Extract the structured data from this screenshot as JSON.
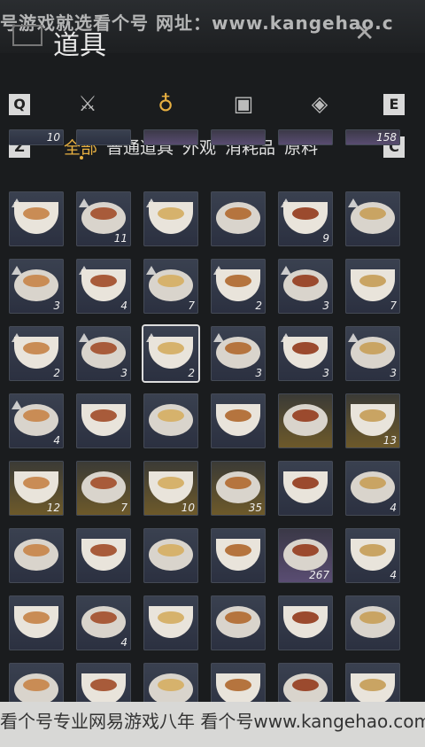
{
  "header": {
    "watermark_top": "号游戏就选看个号  网址：www.kangehao.c",
    "title": "道具",
    "close_icon": "close-x"
  },
  "categories": {
    "left_key": "Q",
    "right_key": "E",
    "icons": [
      "crossed-swords-icon",
      "pouch-icon",
      "chest-icon",
      "gem-icon"
    ],
    "active_index": 1
  },
  "tabs": {
    "left_key": "Z",
    "right_key": "C",
    "items": [
      "全部",
      "普通道具",
      "外观",
      "消耗品",
      "原料"
    ],
    "active_index": 0
  },
  "inventory": [
    {
      "row": 0,
      "col": 0,
      "qty": "10",
      "style": "blue"
    },
    {
      "row": 0,
      "col": 1,
      "qty": "",
      "style": "blue"
    },
    {
      "row": 0,
      "col": 2,
      "qty": "",
      "style": "purple"
    },
    {
      "row": 0,
      "col": 3,
      "qty": "",
      "style": "purple"
    },
    {
      "row": 0,
      "col": 4,
      "qty": "",
      "style": "purple"
    },
    {
      "row": 0,
      "col": 5,
      "qty": "158",
      "style": "purple"
    },
    {
      "row": 1,
      "col": 0,
      "qty": "",
      "style": "blue",
      "badge": true
    },
    {
      "row": 1,
      "col": 1,
      "qty": "11",
      "style": "blue",
      "badge": true
    },
    {
      "row": 1,
      "col": 2,
      "qty": "",
      "style": "blue",
      "badge": true
    },
    {
      "row": 1,
      "col": 3,
      "qty": "",
      "style": "blue"
    },
    {
      "row": 1,
      "col": 4,
      "qty": "9",
      "style": "blue",
      "badge": true
    },
    {
      "row": 1,
      "col": 5,
      "qty": "",
      "style": "blue",
      "badge": true
    },
    {
      "row": 2,
      "col": 0,
      "qty": "3",
      "style": "blue",
      "badge": true
    },
    {
      "row": 2,
      "col": 1,
      "qty": "4",
      "style": "blue",
      "badge": true
    },
    {
      "row": 2,
      "col": 2,
      "qty": "7",
      "style": "blue",
      "badge": true
    },
    {
      "row": 2,
      "col": 3,
      "qty": "2",
      "style": "blue",
      "badge": true
    },
    {
      "row": 2,
      "col": 4,
      "qty": "3",
      "style": "blue",
      "badge": true
    },
    {
      "row": 2,
      "col": 5,
      "qty": "7",
      "style": "blue"
    },
    {
      "row": 3,
      "col": 0,
      "qty": "2",
      "style": "blue",
      "badge": true
    },
    {
      "row": 3,
      "col": 1,
      "qty": "3",
      "style": "blue",
      "badge": true
    },
    {
      "row": 3,
      "col": 2,
      "qty": "2",
      "style": "blue",
      "badge": true,
      "selected": true
    },
    {
      "row": 3,
      "col": 3,
      "qty": "3",
      "style": "blue",
      "badge": true
    },
    {
      "row": 3,
      "col": 4,
      "qty": "3",
      "style": "blue",
      "badge": true
    },
    {
      "row": 3,
      "col": 5,
      "qty": "3",
      "style": "blue",
      "badge": true
    },
    {
      "row": 4,
      "col": 0,
      "qty": "4",
      "style": "blue",
      "badge": true
    },
    {
      "row": 4,
      "col": 1,
      "qty": "",
      "style": "blue"
    },
    {
      "row": 4,
      "col": 2,
      "qty": "",
      "style": "blue"
    },
    {
      "row": 4,
      "col": 3,
      "qty": "",
      "style": "blue"
    },
    {
      "row": 4,
      "col": 4,
      "qty": "",
      "style": "gold"
    },
    {
      "row": 4,
      "col": 5,
      "qty": "13",
      "style": "gold"
    },
    {
      "row": 5,
      "col": 0,
      "qty": "12",
      "style": "gold"
    },
    {
      "row": 5,
      "col": 1,
      "qty": "7",
      "style": "gold"
    },
    {
      "row": 5,
      "col": 2,
      "qty": "10",
      "style": "gold"
    },
    {
      "row": 5,
      "col": 3,
      "qty": "35",
      "style": "gold"
    },
    {
      "row": 5,
      "col": 4,
      "qty": "",
      "style": "blue"
    },
    {
      "row": 5,
      "col": 5,
      "qty": "4",
      "style": "blue"
    },
    {
      "row": 6,
      "col": 0,
      "qty": "",
      "style": "blue"
    },
    {
      "row": 6,
      "col": 1,
      "qty": "",
      "style": "blue"
    },
    {
      "row": 6,
      "col": 2,
      "qty": "",
      "style": "blue"
    },
    {
      "row": 6,
      "col": 3,
      "qty": "",
      "style": "blue"
    },
    {
      "row": 6,
      "col": 4,
      "qty": "267",
      "style": "purple"
    },
    {
      "row": 6,
      "col": 5,
      "qty": "4",
      "style": "blue"
    },
    {
      "row": 7,
      "col": 0,
      "qty": "",
      "style": "blue"
    },
    {
      "row": 7,
      "col": 1,
      "qty": "4",
      "style": "blue"
    },
    {
      "row": 7,
      "col": 2,
      "qty": "",
      "style": "blue"
    },
    {
      "row": 7,
      "col": 3,
      "qty": "",
      "style": "blue"
    },
    {
      "row": 7,
      "col": 4,
      "qty": "",
      "style": "blue"
    },
    {
      "row": 7,
      "col": 5,
      "qty": "",
      "style": "blue"
    },
    {
      "row": 8,
      "col": 0,
      "qty": "",
      "style": "blue"
    },
    {
      "row": 8,
      "col": 1,
      "qty": "",
      "style": "blue"
    },
    {
      "row": 8,
      "col": 2,
      "qty": "",
      "style": "blue"
    },
    {
      "row": 8,
      "col": 3,
      "qty": "",
      "style": "blue"
    },
    {
      "row": 8,
      "col": 4,
      "qty": "",
      "style": "blue"
    },
    {
      "row": 8,
      "col": 5,
      "qty": "",
      "style": "blue"
    }
  ],
  "watermark_bottom": "看个号专业网易游戏八年  看个号www.kangehao.com  交易额超过百亿"
}
